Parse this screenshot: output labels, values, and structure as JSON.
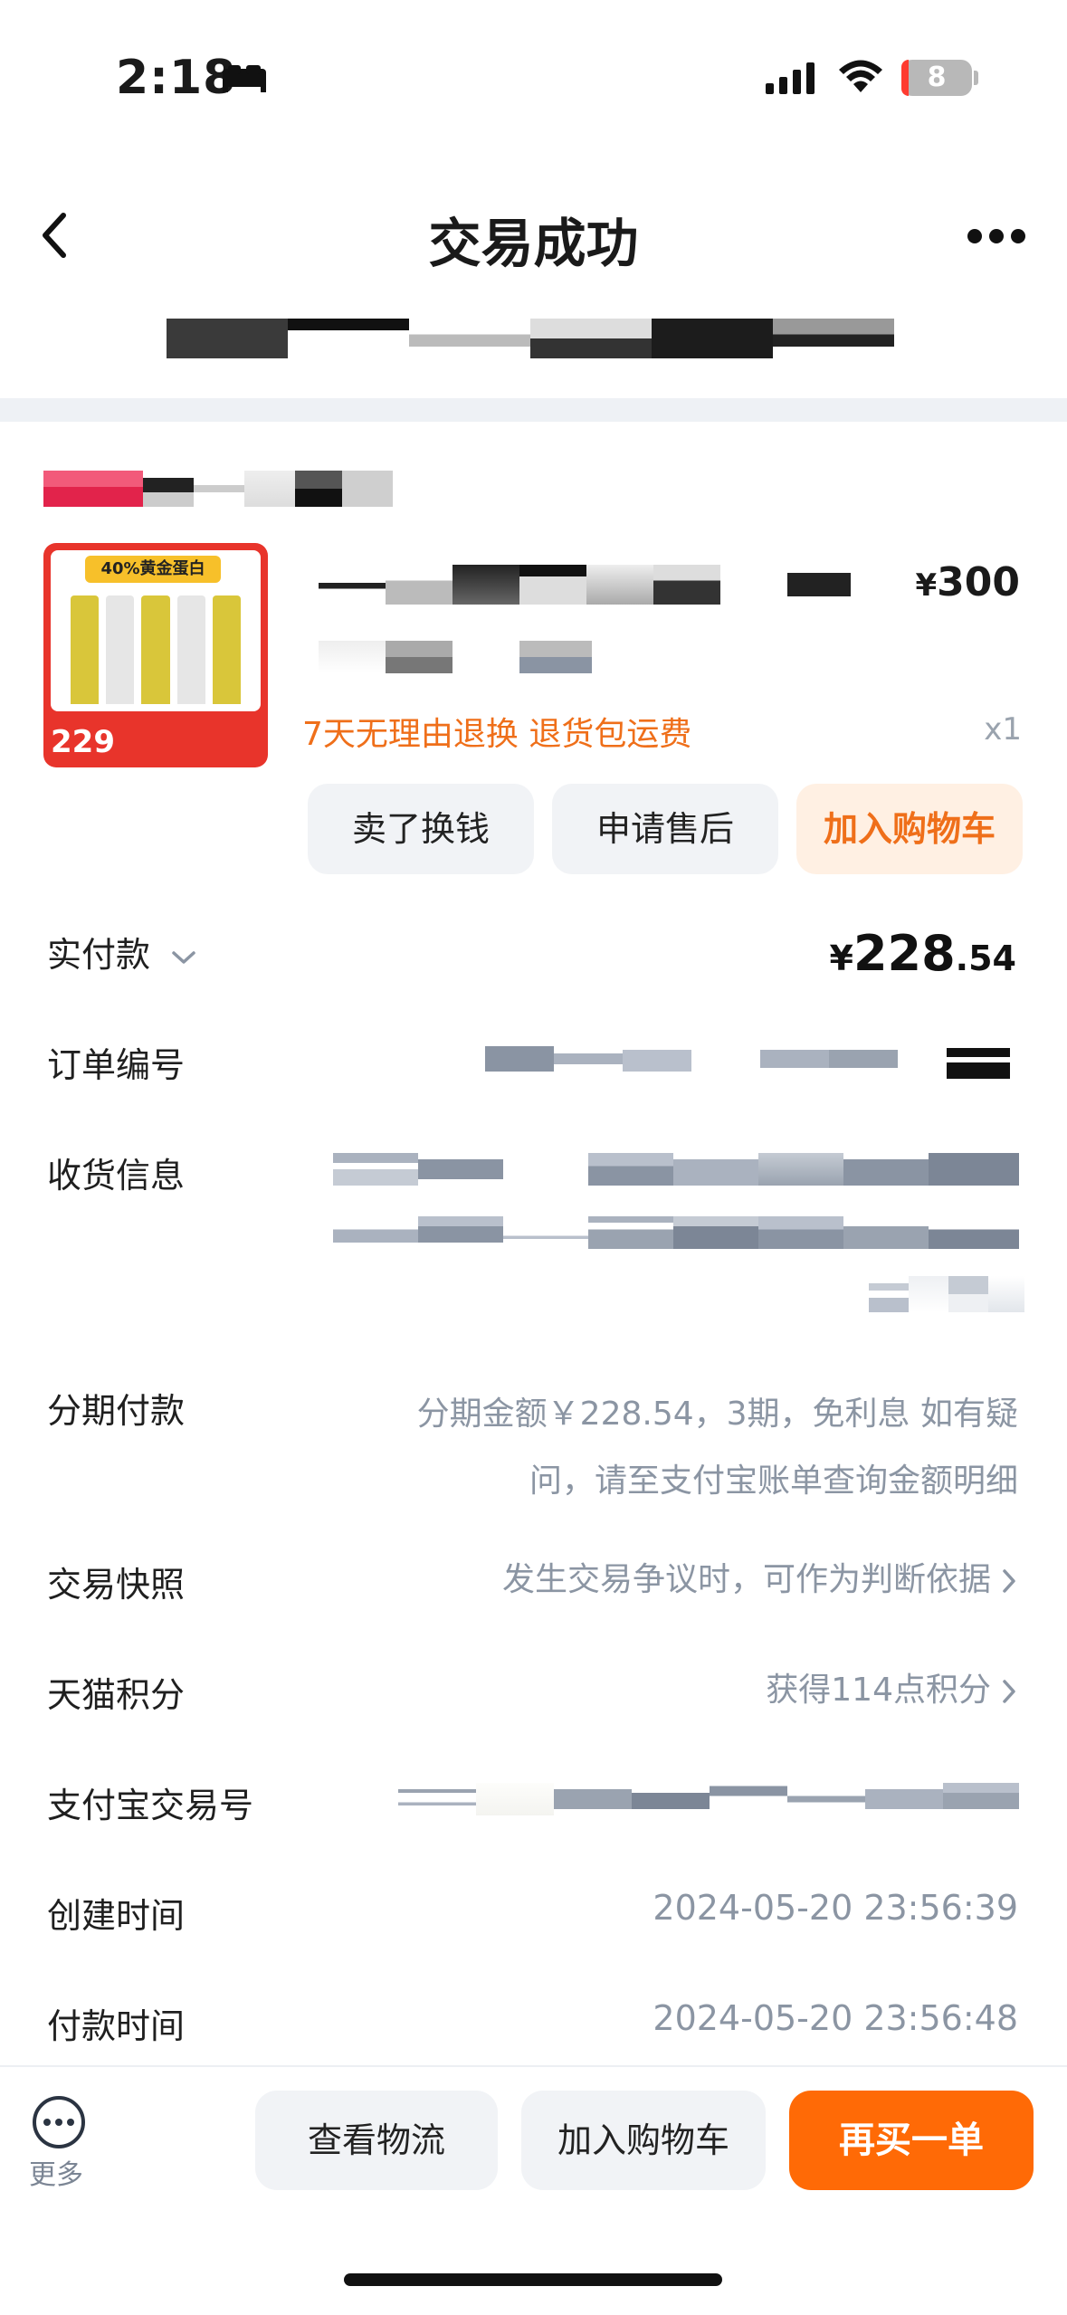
{
  "status_bar": {
    "time": "2:18",
    "battery": "8"
  },
  "nav": {
    "title": "交易成功"
  },
  "product": {
    "thumb_banner": "40%黄金蛋白",
    "thumb_price": "229",
    "price_symbol": "¥",
    "price": "300",
    "promo": "7天无理由退换  退货包运费",
    "quantity": "x1"
  },
  "product_actions": {
    "sell": "卖了换钱",
    "after_sale": "申请售后",
    "add_cart": "加入购物车"
  },
  "rows": {
    "paid_label": "实付款",
    "paid_symbol": "¥",
    "paid_int": "228",
    "paid_dec": ".54",
    "order_no_label": "订单编号",
    "shipping_label": "收货信息",
    "installment_label": "分期付款",
    "installment_line1": "分期金额￥228.54，3期，免利息 如有疑",
    "installment_line2": "问，请至支付宝账单查询金额明细",
    "snapshot_label": "交易快照",
    "snapshot_value": "发生交易争议时，可作为判断依据",
    "points_label": "天猫积分",
    "points_value": "获得114点积分",
    "alipay_label": "支付宝交易号",
    "created_label": "创建时间",
    "created_value": "2024-05-20 23:56:39",
    "paid_time_label": "付款时间",
    "paid_time_value": "2024-05-20 23:56:48"
  },
  "bottom_bar": {
    "more": "更多",
    "logistics": "查看物流",
    "add_cart": "加入购物车",
    "buy_again": "再买一单"
  },
  "colors": {
    "accent": "#ff6a06",
    "promo": "#ef6f1a",
    "muted": "#8b95a3"
  }
}
